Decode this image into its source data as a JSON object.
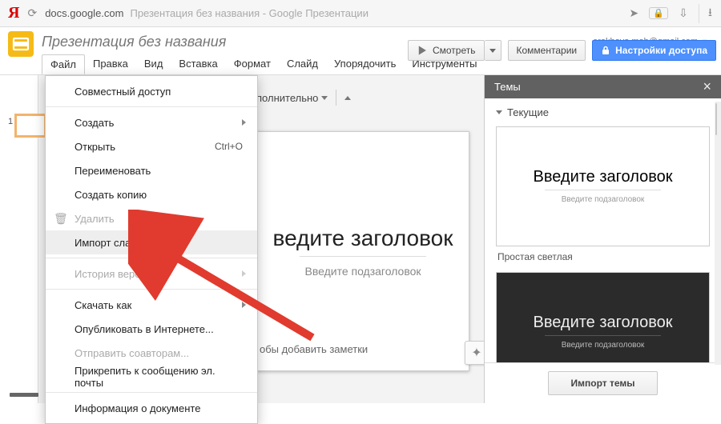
{
  "browser": {
    "url_host": "docs.google.com",
    "tab_title": "Презентация без названия - Google Презентации"
  },
  "header": {
    "doc_title": "Презентация без названия",
    "user_email": "erokhova.mob@gmail.com"
  },
  "menubar": {
    "items": [
      "Файл",
      "Правка",
      "Вид",
      "Вставка",
      "Формат",
      "Слайд",
      "Упорядочить",
      "Инструменты"
    ],
    "active_index": 0
  },
  "header_buttons": {
    "present": "Смотреть",
    "comments": "Комментарии",
    "share": "Настройки доступа"
  },
  "toolbar": {
    "more_label": "полнительно"
  },
  "file_menu": {
    "share": "Совместный доступ",
    "new": "Создать",
    "open": "Открыть",
    "open_shortcut": "Ctrl+O",
    "rename": "Переименовать",
    "make_copy": "Создать копию",
    "delete": "Удалить",
    "import_slides": "Импорт слайдов...",
    "version_history": "История версий",
    "download_as": "Скачать как",
    "publish": "Опубликовать в Интернете...",
    "email_collab": "Отправить соавторам...",
    "attach_email": "Прикрепить к сообщению эл. почты",
    "doc_info": "Информация о документе"
  },
  "slide": {
    "title_placeholder": "ведите заголовок",
    "subtitle_placeholder": "Введите подзаголовок",
    "notes_hint": "обы добавить заметки"
  },
  "thumbnails": {
    "first_index": "1"
  },
  "themes_panel": {
    "title": "Темы",
    "section_current": "Текущие",
    "card_title": "Введите заголовок",
    "card_subtitle": "Введите подзаголовок",
    "theme1_name": "Простая светлая",
    "import_btn": "Импорт темы"
  }
}
